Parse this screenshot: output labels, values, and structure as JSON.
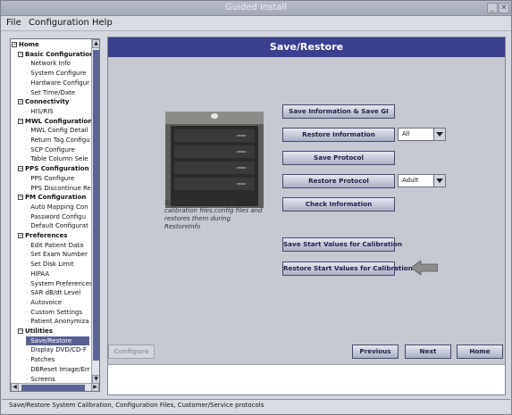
{
  "window": {
    "title": "Guided Install"
  },
  "menu": [
    "File",
    "Configuration",
    "Help"
  ],
  "tree": [
    {
      "label": "Home",
      "level": 0,
      "box": "−"
    },
    {
      "label": "Basic Configuration",
      "level": 1,
      "box": "−"
    },
    {
      "label": "Network Info",
      "level": 2
    },
    {
      "label": "System Configure",
      "level": 2
    },
    {
      "label": "Hardware Configur",
      "level": 2
    },
    {
      "label": "Set Time/Date",
      "level": 2
    },
    {
      "label": "Connectivity",
      "level": 1,
      "box": "−"
    },
    {
      "label": "HIS/RIS",
      "level": 2
    },
    {
      "label": "MWL Configuration",
      "level": 1,
      "box": "−"
    },
    {
      "label": "MWL Config Detail",
      "level": 2
    },
    {
      "label": "Return Tag Configu",
      "level": 2
    },
    {
      "label": "SCP Configure",
      "level": 2
    },
    {
      "label": "Table Column Sele",
      "level": 2
    },
    {
      "label": "PPS Configuration",
      "level": 1,
      "box": "−"
    },
    {
      "label": "PPS Configure",
      "level": 2
    },
    {
      "label": "PPS Discontinue Re",
      "level": 2
    },
    {
      "label": "PM Configuration",
      "level": 1,
      "box": "−"
    },
    {
      "label": "Auto Mapping Con",
      "level": 2
    },
    {
      "label": "Password Configu",
      "level": 2
    },
    {
      "label": "Default Configurat",
      "level": 2
    },
    {
      "label": "Preferences",
      "level": 1,
      "box": "−"
    },
    {
      "label": "Edit Patient Data",
      "level": 2
    },
    {
      "label": "Set Exam Number",
      "level": 2
    },
    {
      "label": "Set Disk Limit",
      "level": 2
    },
    {
      "label": "HIPAA",
      "level": 2
    },
    {
      "label": "System Preferences",
      "level": 2
    },
    {
      "label": "SAR dB/dt Level",
      "level": 2
    },
    {
      "label": "Autovoice",
      "level": 2
    },
    {
      "label": "Custom Settings",
      "level": 2
    },
    {
      "label": "Patient Anonymiza",
      "level": 2
    },
    {
      "label": "Utilities",
      "level": 1,
      "box": "−"
    },
    {
      "label": "Save/Restore",
      "level": 2,
      "selected": true
    },
    {
      "label": "Display DVD/CD-F",
      "level": 2
    },
    {
      "label": "Patches",
      "level": 2
    },
    {
      "label": "DBReset Image/Err",
      "level": 2
    },
    {
      "label": "Screens",
      "level": 2
    }
  ],
  "main": {
    "header": "Save/Restore",
    "caption": "SaveInfo saves system calibration files,config files and restores them during RestoreInfo",
    "buttons": {
      "save_info": "Save Information & Save GI",
      "restore_info": "Restore Information",
      "save_protocol": "Save Protocol",
      "restore_protocol": "Restore Protocol",
      "check_info": "Check Information",
      "save_start": "Save Start Values for Calibration",
      "restore_start": "Restore Start Values for Calibration"
    },
    "selects": {
      "restore_info": "All",
      "restore_protocol": "Adult"
    },
    "bottom": {
      "configure": "Configure",
      "previous": "Previous",
      "next": "Next",
      "home": "Home"
    }
  },
  "status": "Save/Restore System Calibration, Configuration Files, Customer/Service protocols",
  "colors": {
    "header": "#3b3f90",
    "selection": "#5a6092",
    "arrow": "#8c8c8c"
  }
}
